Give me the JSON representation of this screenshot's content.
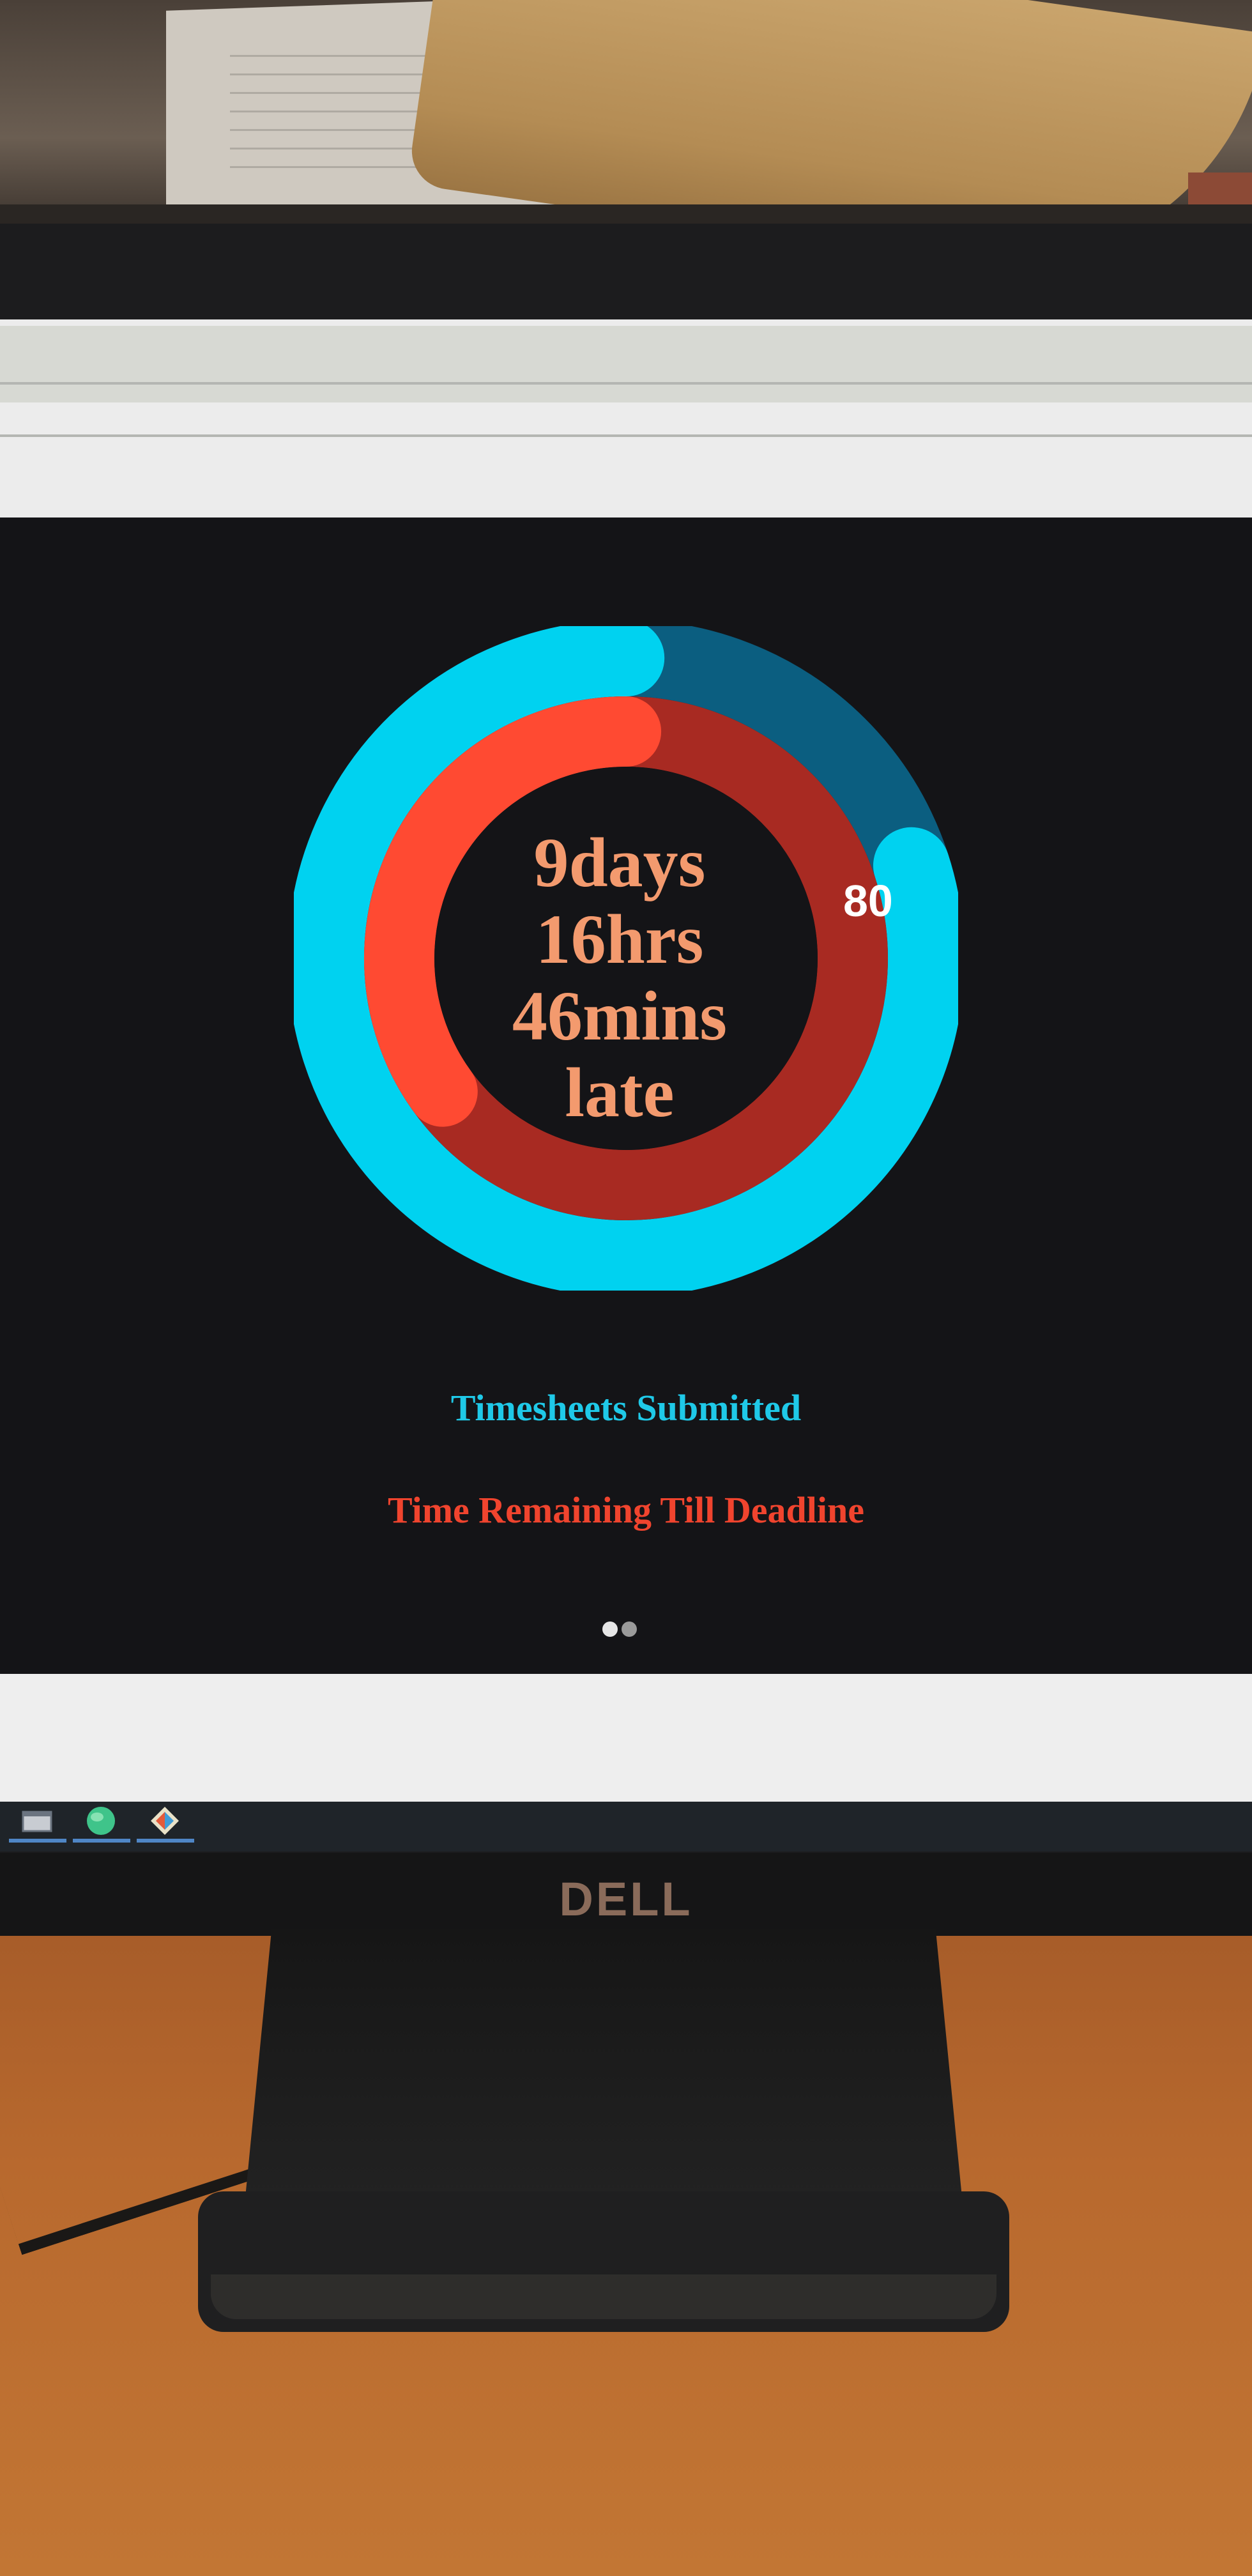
{
  "dashboard": {
    "center_lines": [
      "9days",
      "16hrs",
      "46mins",
      "late"
    ],
    "outer_ring_value": "80",
    "outer_ring_fill_fraction": 0.8,
    "inner_ring_fill_fraction": 0.35,
    "legend_submitted": "Timesheets Submitted",
    "legend_deadline": "Time Remaining Till Deadline",
    "pager": {
      "active_index": 0,
      "count": 2
    }
  },
  "monitor": {
    "brand": "DELL"
  },
  "colors": {
    "submitted_fill": "#00d2f0",
    "submitted_track": "#0b5e80",
    "deadline_fill": "#ff4a32",
    "deadline_track": "#a82a22",
    "center_text": "#f39a6e",
    "background": "#141417"
  },
  "taskbar": {
    "icons": [
      "window-icon",
      "globe-icon",
      "app-icon"
    ]
  }
}
